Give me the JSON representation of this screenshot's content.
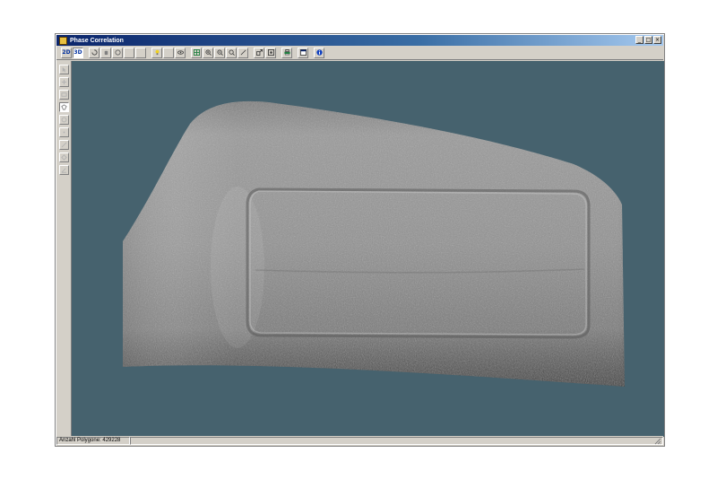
{
  "window": {
    "title": "Phase Correlation",
    "buttons": [
      "_",
      "□",
      "×"
    ]
  },
  "toolbar": {
    "mode_2d": "2D",
    "mode_3d": "3D"
  },
  "statusbar": {
    "polygon_count": "Anzahl Polygone: 429228"
  },
  "colors": {
    "viewport_background": "#46626e",
    "title_bar": "#0a246a",
    "window_chrome": "#d4d0c8"
  }
}
